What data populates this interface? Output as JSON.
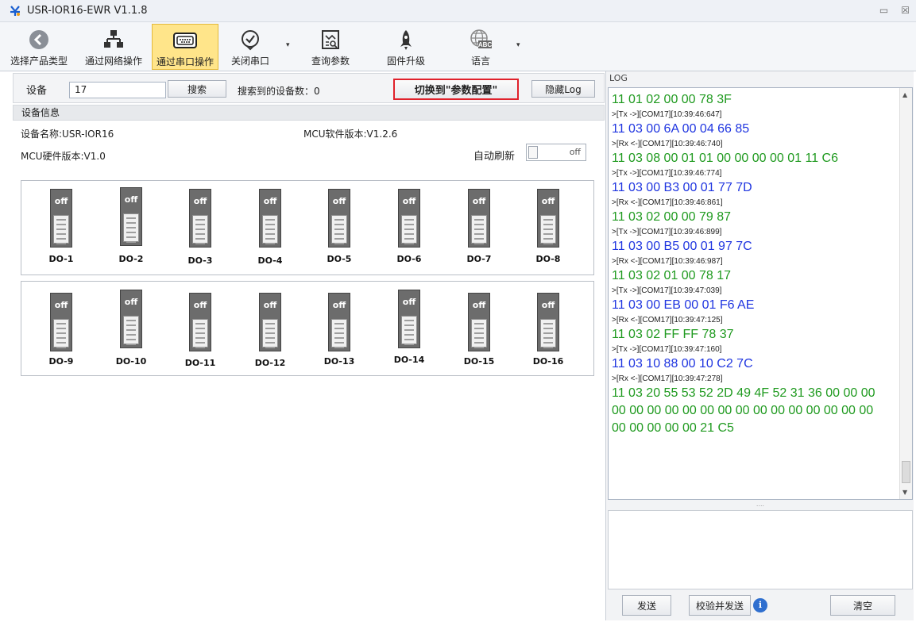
{
  "window": {
    "title": "USR-IOR16-EWR V1.1.8",
    "minimize_glyph": "▭",
    "close_glyph": "☒"
  },
  "toolbar": {
    "items": [
      {
        "label": "选择产品类型",
        "icon": "back-arrow-icon"
      },
      {
        "label": "通过网络操作",
        "icon": "network-icon"
      },
      {
        "label": "通过串口操作",
        "icon": "serial-port-icon",
        "active": true
      },
      {
        "label": "关闭串口",
        "icon": "check-circle-icon"
      },
      {
        "label": "查询参数",
        "icon": "query-icon"
      },
      {
        "label": "固件升级",
        "icon": "rocket-icon"
      },
      {
        "label": "语言",
        "icon": "globe-abc-icon"
      }
    ],
    "dropdown_glyph": "▾"
  },
  "search": {
    "device_label": "设备",
    "device_value": "17",
    "search_button": "搜索",
    "found_text": "搜索到的设备数：0",
    "switch_button": "切换到\"参数配置\"",
    "hide_log_button": "隐藏Log"
  },
  "device_info": {
    "section_title": "设备信息",
    "device_name": "设备名称:USR-IOR16",
    "mcu_software": "MCU软件版本:V1.2.6",
    "mcu_hardware": "MCU硬件版本:V1.0",
    "auto_refresh_label": "自动刷新",
    "auto_refresh_state": "off"
  },
  "outputs": {
    "state_text": "off",
    "names": [
      "DO-1",
      "DO-2",
      "DO-3",
      "DO-4",
      "DO-5",
      "DO-6",
      "DO-7",
      "DO-8",
      "DO-9",
      "DO-10",
      "DO-11",
      "DO-12",
      "DO-13",
      "DO-14",
      "DO-15",
      "DO-16"
    ]
  },
  "log": {
    "header": "LOG",
    "lines": [
      {
        "text": "11 01 02 00 00 78 3F",
        "kind": "hex",
        "color": "green"
      },
      {
        "text": ">[Tx ->][COM17][10:39:46:647]",
        "kind": "meta"
      },
      {
        "text": "11 03 00 6A 00 04 66 85",
        "kind": "hex",
        "color": "blue"
      },
      {
        "text": ">[Rx <-][COM17][10:39:46:740]",
        "kind": "meta"
      },
      {
        "text": "11 03 08 00 01 01 00 00 00 00 01 11 C6",
        "kind": "hex",
        "color": "green"
      },
      {
        "text": ">[Tx ->][COM17][10:39:46:774]",
        "kind": "meta"
      },
      {
        "text": "11 03 00 B3 00 01 77 7D",
        "kind": "hex",
        "color": "blue"
      },
      {
        "text": ">[Rx <-][COM17][10:39:46:861]",
        "kind": "meta"
      },
      {
        "text": "11 03 02 00 00 79 87",
        "kind": "hex",
        "color": "green"
      },
      {
        "text": ">[Tx ->][COM17][10:39:46:899]",
        "kind": "meta"
      },
      {
        "text": "11 03 00 B5 00 01 97 7C",
        "kind": "hex",
        "color": "blue"
      },
      {
        "text": ">[Rx <-][COM17][10:39:46:987]",
        "kind": "meta"
      },
      {
        "text": "11 03 02 01 00 78 17",
        "kind": "hex",
        "color": "green"
      },
      {
        "text": ">[Tx ->][COM17][10:39:47:039]",
        "kind": "meta"
      },
      {
        "text": "11 03 00 EB 00 01 F6 AE",
        "kind": "hex",
        "color": "blue"
      },
      {
        "text": ">[Rx <-][COM17][10:39:47:125]",
        "kind": "meta"
      },
      {
        "text": "11 03 02 FF FF 78 37",
        "kind": "hex",
        "color": "green"
      },
      {
        "text": ">[Tx ->][COM17][10:39:47:160]",
        "kind": "meta"
      },
      {
        "text": "11 03 10 88 00 10 C2 7C",
        "kind": "hex",
        "color": "blue"
      },
      {
        "text": ">[Rx <-][COM17][10:39:47:278]",
        "kind": "meta"
      },
      {
        "text": "11 03 20 55 53 52 2D 49 4F 52 31 36 00 00 00",
        "kind": "hex",
        "color": "green"
      },
      {
        "text": "00 00 00 00 00 00 00 00 00 00 00 00 00 00 00",
        "kind": "hex",
        "color": "green"
      },
      {
        "text": "00 00 00 00 00 21 C5",
        "kind": "hex",
        "color": "green"
      }
    ],
    "splitter_glyph": "....",
    "send_button": "发送",
    "verify_send_button": "校验并发送",
    "clear_button": "清空",
    "info_glyph": "i"
  },
  "colors": {
    "log_green": "#1f9a1f",
    "log_blue": "#1f35e0",
    "highlight_border": "#e0212b",
    "active_tool_bg": "#ffe58a"
  }
}
